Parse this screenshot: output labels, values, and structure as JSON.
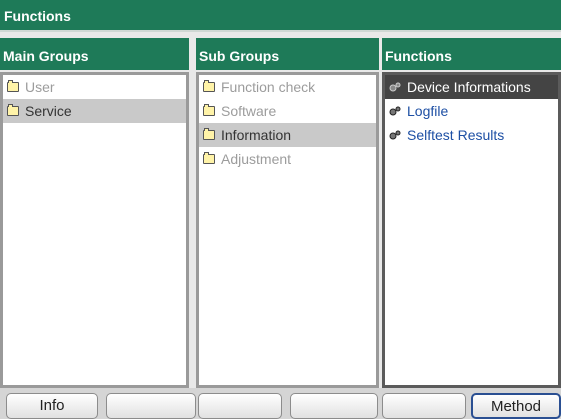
{
  "title": "Functions",
  "columns": {
    "main": {
      "header": "Main Groups",
      "items": [
        "User",
        "Service"
      ]
    },
    "sub": {
      "header": "Sub Groups",
      "items": [
        "Function check",
        "Software",
        "Information",
        "Adjustment"
      ]
    },
    "functions": {
      "header": "Functions",
      "items": [
        "Device Informations",
        "Logfile",
        "Selftest Results"
      ]
    }
  },
  "footer": {
    "buttons": [
      "Info",
      "",
      "",
      "",
      "",
      "Method"
    ]
  },
  "colors": {
    "header_green": "#1e7a58",
    "link_blue": "#1d4fa4",
    "selection_grey": "#c9c9c9",
    "selection_dark": "#444444"
  }
}
